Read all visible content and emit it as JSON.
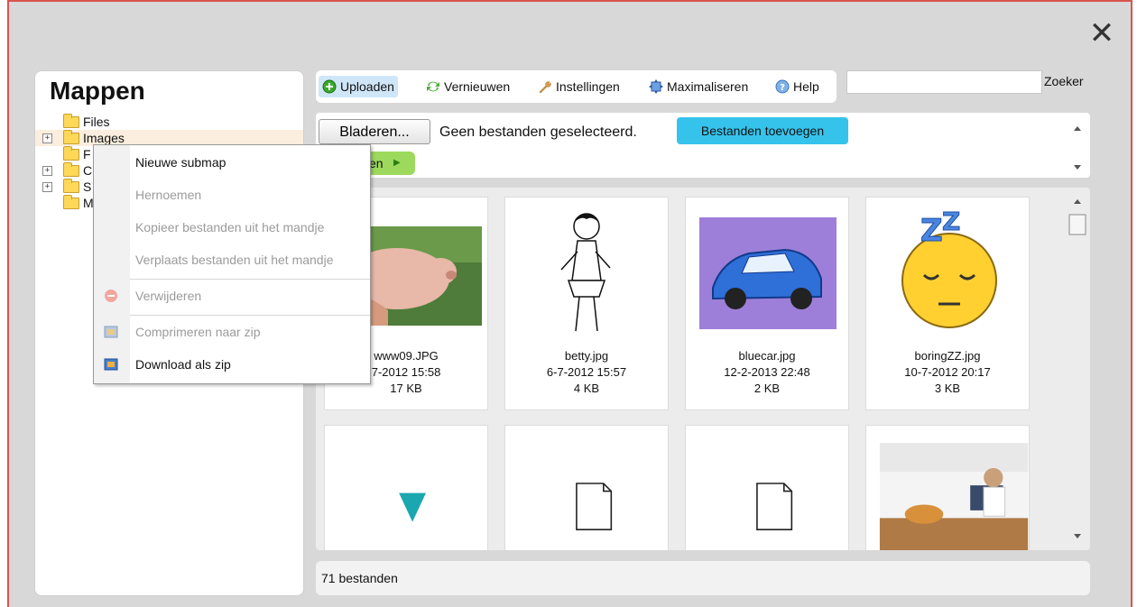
{
  "dialog": {
    "close_symbol": "✕"
  },
  "left": {
    "title": "Mappen",
    "tree": [
      {
        "label": "Files",
        "expandable": false
      },
      {
        "label": "Images",
        "expandable": true
      },
      {
        "label": "F",
        "expandable": false
      },
      {
        "label": "C",
        "expandable": true
      },
      {
        "label": "S",
        "expandable": true
      },
      {
        "label": "M",
        "expandable": false
      }
    ],
    "expand_symbol": "+"
  },
  "toolbar": {
    "upload": "Uploaden",
    "refresh": "Vernieuwen",
    "settings": "Instellingen",
    "maximize": "Maximaliseren",
    "help": "Help"
  },
  "search": {
    "placeholder": "",
    "button": "Zoeker"
  },
  "upload": {
    "browse": "Bladeren...",
    "no_files": "Geen bestanden geselecteerd.",
    "add_files": "Bestanden toevoegen",
    "green_label": "en"
  },
  "files": [
    {
      "name": "www09.JPG",
      "date": "7-2012 15:58",
      "size": "17 KB"
    },
    {
      "name": "betty.jpg",
      "date": "6-7-2012 15:57",
      "size": "4 KB"
    },
    {
      "name": "bluecar.jpg",
      "date": "12-2-2013 22:48",
      "size": "2 KB"
    },
    {
      "name": "boringZZ.jpg",
      "date": "10-7-2012 20:17",
      "size": "3 KB"
    }
  ],
  "status": {
    "count": "71 bestanden"
  },
  "context_menu": {
    "items": [
      {
        "label": "Nieuwe submap",
        "enabled": true
      },
      {
        "label": "Hernoemen",
        "enabled": false
      },
      {
        "label": "Kopieer bestanden uit het mandje",
        "enabled": false
      },
      {
        "label": "Verplaats bestanden uit het mandje",
        "enabled": false
      },
      {
        "label": "Verwijderen",
        "enabled": false
      },
      {
        "label": "Comprimeren naar zip",
        "enabled": false
      },
      {
        "label": "Download als zip",
        "enabled": true
      }
    ]
  },
  "colors": {
    "accent_blue": "#36c3eb",
    "accent_green": "#9cd95d",
    "frame_border": "#d9534f"
  }
}
